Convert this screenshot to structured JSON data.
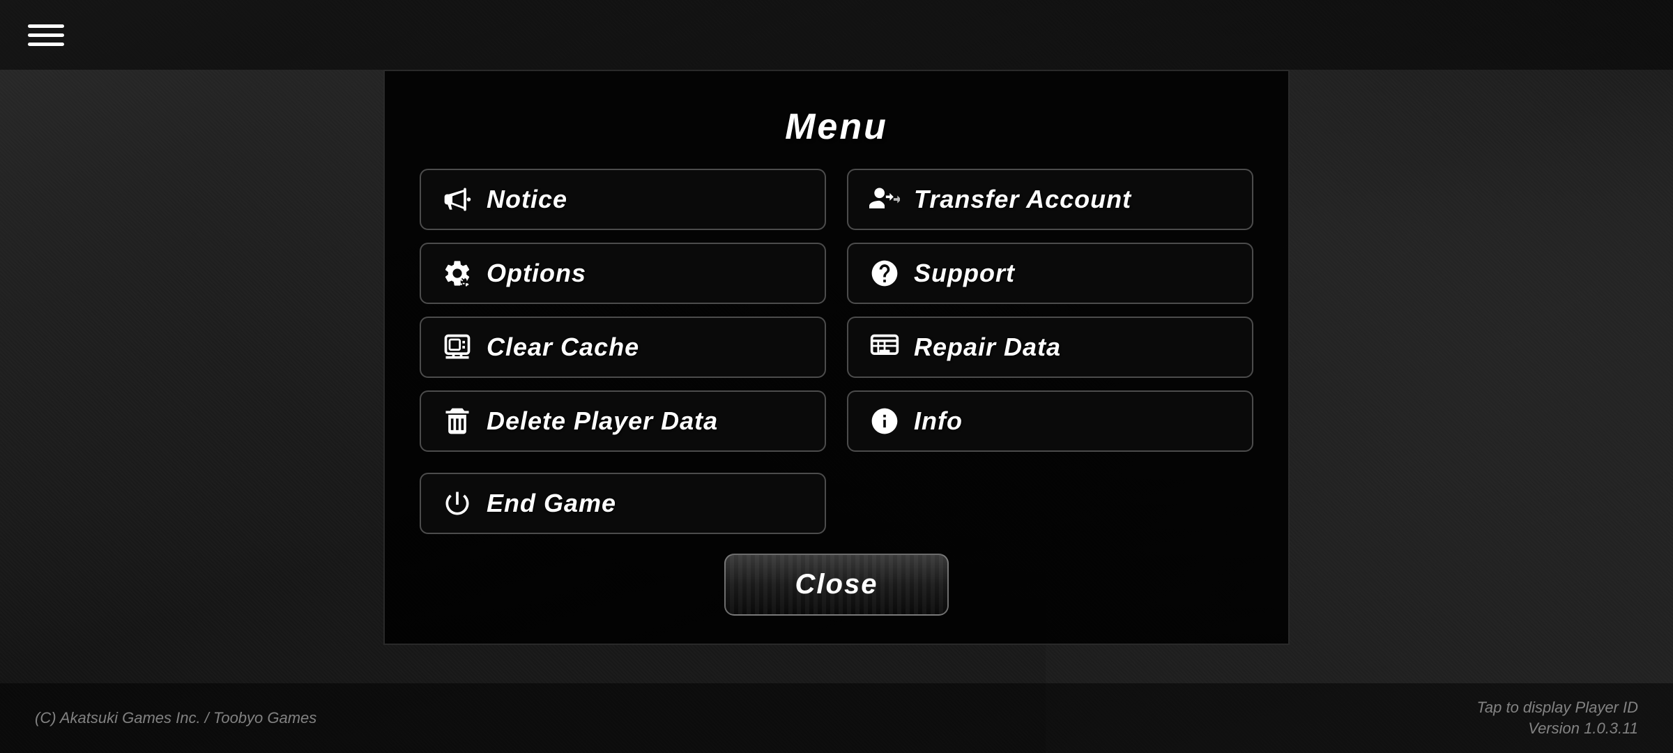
{
  "topbar": {
    "hamburger_aria": "hamburger-menu"
  },
  "menu": {
    "title": "Menu",
    "buttons": {
      "left": [
        {
          "id": "notice",
          "label": "Notice",
          "icon": "megaphone"
        },
        {
          "id": "options",
          "label": "Options",
          "icon": "gear"
        },
        {
          "id": "clear-cache",
          "label": "Clear Cache",
          "icon": "cache"
        },
        {
          "id": "delete-player-data",
          "label": "Delete Player Data",
          "icon": "trash"
        },
        {
          "id": "end-game",
          "label": "End Game",
          "icon": "power"
        }
      ],
      "right": [
        {
          "id": "transfer-account",
          "label": "Transfer Account",
          "icon": "transfer"
        },
        {
          "id": "support",
          "label": "Support",
          "icon": "question"
        },
        {
          "id": "repair-data",
          "label": "Repair Data",
          "icon": "repair"
        },
        {
          "id": "info",
          "label": "Info",
          "icon": "info"
        }
      ]
    },
    "close_label": "Close"
  },
  "footer": {
    "copyright": "(C) Akatsuki Games Inc. / Toobyo Games",
    "player_id_prompt": "Tap to display Player ID",
    "version": "Version 1.0.3.11"
  }
}
